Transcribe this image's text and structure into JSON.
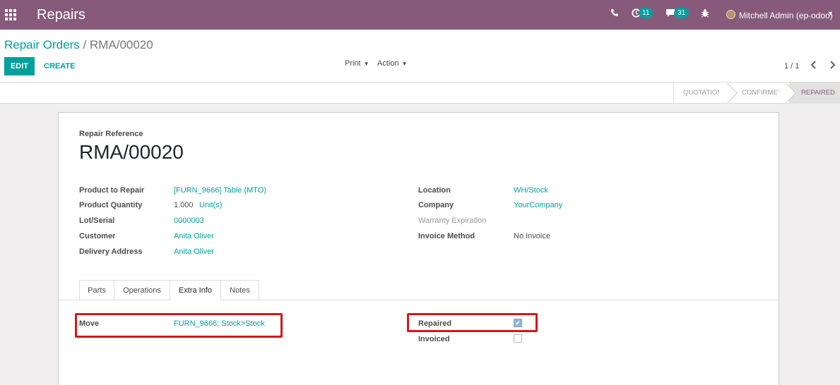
{
  "navbar": {
    "app_title": "Repairs",
    "activity_count": "11",
    "messages_count": "31",
    "user_name": "Mitchell Admin (ep-odoo)"
  },
  "breadcrumb": {
    "parent": "Repair Orders",
    "separator": "/",
    "current": "RMA/00020"
  },
  "toolbar": {
    "edit_label": "EDIT",
    "create_label": "CREATE",
    "print_label": "Print",
    "action_label": "Action",
    "pager": "1 / 1"
  },
  "statusbar": {
    "stages": [
      "QUOTATION",
      "CONFIRMED",
      "REPAIRED"
    ],
    "active_stage": "REPAIRED"
  },
  "form": {
    "ref_label": "Repair Reference",
    "ref_value": "RMA/00020",
    "left_fields": {
      "product_label": "Product to Repair",
      "product_value": "[FURN_9666] Table (MTO)",
      "qty_label": "Product Quantity",
      "qty_value": "1.000",
      "qty_uom": "Unit(s)",
      "lot_label": "Lot/Serial",
      "lot_value": "0000003",
      "customer_label": "Customer",
      "customer_value": "Anita Oliver",
      "delivery_label": "Delivery Address",
      "delivery_value": "Anita Oliver"
    },
    "right_fields": {
      "location_label": "Location",
      "location_value": "WH/Stock",
      "company_label": "Company",
      "company_value": "YourCompany",
      "warranty_label": "Warranty Expiration",
      "invoice_method_label": "Invoice Method",
      "invoice_method_value": "No Invoice"
    },
    "tabs": [
      "Parts",
      "Operations",
      "Extra Info",
      "Notes"
    ],
    "active_tab": "Extra Info",
    "extra_info": {
      "move_label": "Move",
      "move_value": "FURN_9666: Stock>Stock",
      "repaired_label": "Repaired",
      "repaired_checked": true,
      "invoiced_label": "Invoiced",
      "invoiced_checked": false
    }
  },
  "colors": {
    "brand": "#875a7b",
    "accent": "#00a09d",
    "highlight": "#d0191c"
  },
  "icons": [
    "apps-grid-icon",
    "phone-icon",
    "clock-icon",
    "chat-icon",
    "bug-icon",
    "avatar-icon",
    "caret-down-icon",
    "chevron-left-icon",
    "chevron-right-icon",
    "checkmark-icon"
  ]
}
